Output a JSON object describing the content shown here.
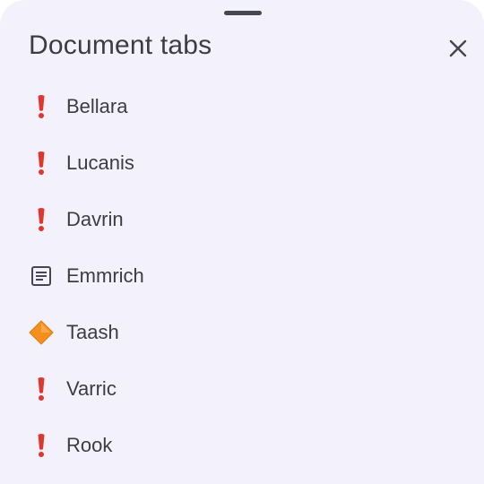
{
  "sheet": {
    "title": "Document tabs",
    "close_icon": "close-icon"
  },
  "tabs": [
    {
      "label": "Bellara",
      "icon": "exclamation-icon"
    },
    {
      "label": "Lucanis",
      "icon": "exclamation-icon"
    },
    {
      "label": "Davrin",
      "icon": "exclamation-icon"
    },
    {
      "label": "Emmrich",
      "icon": "document-icon"
    },
    {
      "label": "Taash",
      "icon": "orange-diamond-icon"
    },
    {
      "label": "Varric",
      "icon": "exclamation-icon"
    },
    {
      "label": "Rook",
      "icon": "exclamation-icon"
    }
  ],
  "colors": {
    "sheet_background": "#f3f2fc",
    "exclamation": "#e0362b",
    "diamond": "#f5901e",
    "text": "#3c3c41"
  }
}
